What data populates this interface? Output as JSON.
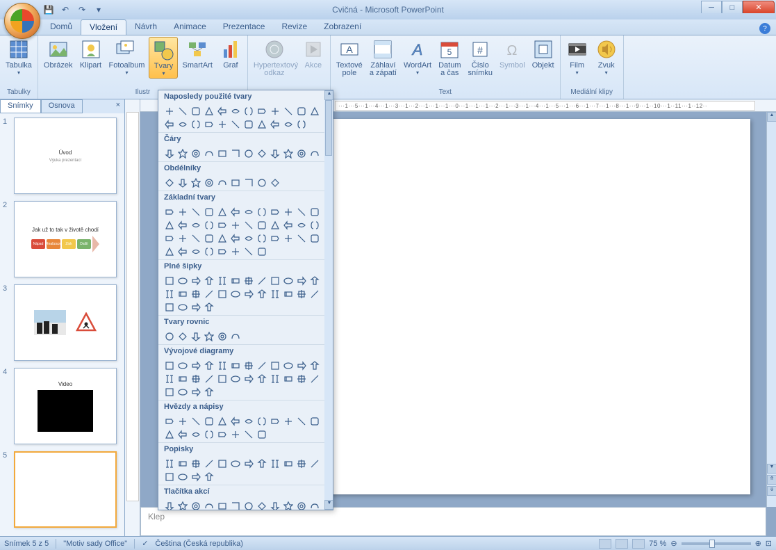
{
  "title": "Cvičná - Microsoft PowerPoint",
  "tabs": [
    "Domů",
    "Vložení",
    "Návrh",
    "Animace",
    "Prezentace",
    "Revize",
    "Zobrazení"
  ],
  "active_tab": 1,
  "ribbon": {
    "groups": [
      {
        "label": "Tabulky",
        "items": [
          {
            "name": "Tabulka",
            "icon": "table"
          }
        ]
      },
      {
        "label": "Ilustr",
        "items": [
          {
            "name": "Obrázek",
            "icon": "picture"
          },
          {
            "name": "Klipart",
            "icon": "clipart"
          },
          {
            "name": "Fotoalbum",
            "icon": "album"
          },
          {
            "name": "Tvary",
            "icon": "shapes",
            "active": true
          },
          {
            "name": "SmartArt",
            "icon": "smartart"
          },
          {
            "name": "Graf",
            "icon": "chart"
          }
        ]
      },
      {
        "label": "",
        "items": [
          {
            "name": "Hypertextový\nodkaz",
            "icon": "link",
            "disabled": true
          },
          {
            "name": "Akce",
            "icon": "action",
            "disabled": true
          }
        ]
      },
      {
        "label": "Text",
        "items": [
          {
            "name": "Textové\npole",
            "icon": "textbox"
          },
          {
            "name": "Záhlaví\na zápatí",
            "icon": "header"
          },
          {
            "name": "WordArt",
            "icon": "wordart"
          },
          {
            "name": "Datum\na čas",
            "icon": "date"
          },
          {
            "name": "Číslo\nsnímku",
            "icon": "number"
          },
          {
            "name": "Symbol",
            "icon": "symbol",
            "disabled": true
          },
          {
            "name": "Objekt",
            "icon": "object"
          }
        ]
      },
      {
        "label": "Mediální klipy",
        "items": [
          {
            "name": "Film",
            "icon": "video"
          },
          {
            "name": "Zvuk",
            "icon": "audio"
          }
        ]
      }
    ]
  },
  "slidetabs": {
    "slides": "Snímky",
    "outline": "Osnova"
  },
  "slides": [
    {
      "num": "1",
      "title": "Úvod",
      "sub": "Výuka prezentací"
    },
    {
      "num": "2",
      "title": "Jak už to tak v životě chodí",
      "type": "process"
    },
    {
      "num": "3",
      "title": "",
      "type": "images"
    },
    {
      "num": "4",
      "title": "Video",
      "type": "video"
    },
    {
      "num": "5",
      "title": "",
      "type": "blank",
      "selected": true
    }
  ],
  "notes_placeholder": "Klep",
  "ruler_text": "···1···5···1···4···1···3···1···2···1···1···1···0···1···1···1···2···1···3···1···4···1···5···1···6···1···7···1···8···1···9···1··10···1··11···1··12··",
  "shapes": {
    "sections": [
      {
        "title": "Naposledy použité tvary",
        "count": 23
      },
      {
        "title": "Čáry",
        "count": 12
      },
      {
        "title": "Obdélníky",
        "count": 9
      },
      {
        "title": "Základní tvary",
        "count": 44
      },
      {
        "title": "Plné šipky",
        "count": 28
      },
      {
        "title": "Tvary rovnic",
        "count": 6
      },
      {
        "title": "Vývojové diagramy",
        "count": 28
      },
      {
        "title": "Hvězdy a nápisy",
        "count": 20
      },
      {
        "title": "Popisky",
        "count": 16
      },
      {
        "title": "Tlačítka akcí",
        "count": 12
      }
    ]
  },
  "status": {
    "slide": "Snímek 5 z 5",
    "theme": "\"Motiv sady Office\"",
    "lang": "Čeština (Česká republika)",
    "zoom": "75 %"
  }
}
